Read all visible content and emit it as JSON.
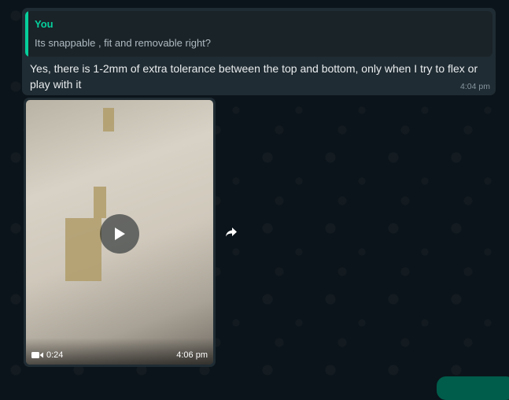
{
  "quoted": {
    "author": "You",
    "text": "Its snappable , fit and removable right?"
  },
  "message": {
    "text": "Yes, there is 1-2mm of extra tolerance between the top and bottom, only when I try to flex or play with it",
    "time": "4:04 pm"
  },
  "video": {
    "duration": "0:24",
    "time": "4:06 pm"
  },
  "icons": {
    "play": "play-icon",
    "camera": "video-camera-icon",
    "forward": "forward-icon"
  },
  "colors": {
    "background": "#0b141a",
    "bubble": "#202c33",
    "accent": "#06cf9c",
    "text": "#e9edef",
    "meta": "#8696a0"
  }
}
